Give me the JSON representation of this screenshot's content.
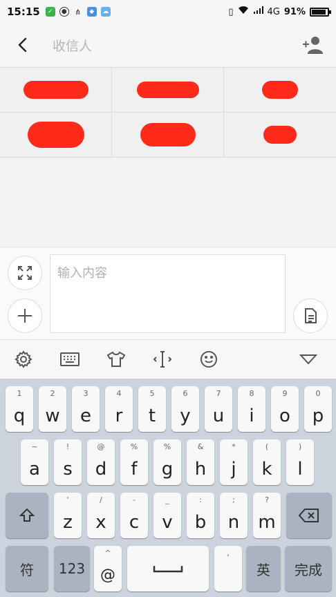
{
  "status_bar": {
    "time": "15:15",
    "network": "4G",
    "battery": "91%",
    "battery_level": 0.91
  },
  "header": {
    "title": "收信人",
    "icons": {
      "back": "chevron-left-icon",
      "add_contact": "add-contact-icon"
    }
  },
  "recipients_grid": {
    "rows": 2,
    "cols": 3
  },
  "compose": {
    "placeholder": "输入内容",
    "icons": {
      "expand": "expand-icon",
      "add": "plus-icon",
      "template": "document-icon"
    }
  },
  "keyboard_toolbar": {
    "icons": [
      "gear-icon",
      "keyboard-icon",
      "tshirt-icon",
      "cursor-icon",
      "emoji-icon",
      "collapse-icon"
    ]
  },
  "keyboard": {
    "row1": [
      {
        "hint": "1",
        "key": "q"
      },
      {
        "hint": "2",
        "key": "w"
      },
      {
        "hint": "3",
        "key": "e"
      },
      {
        "hint": "4",
        "key": "r"
      },
      {
        "hint": "5",
        "key": "t"
      },
      {
        "hint": "6",
        "key": "y"
      },
      {
        "hint": "7",
        "key": "u"
      },
      {
        "hint": "8",
        "key": "i"
      },
      {
        "hint": "9",
        "key": "o"
      },
      {
        "hint": "0",
        "key": "p"
      }
    ],
    "row2": [
      {
        "hint": "~",
        "key": "a"
      },
      {
        "hint": "!",
        "key": "s"
      },
      {
        "hint": "@",
        "key": "d"
      },
      {
        "hint": "%",
        "key": "f"
      },
      {
        "hint": "%",
        "key": "g"
      },
      {
        "hint": "&",
        "key": "h"
      },
      {
        "hint": "*",
        "key": "j"
      },
      {
        "hint": "(",
        "key": "k"
      },
      {
        "hint": ")",
        "key": "l"
      }
    ],
    "row3": [
      {
        "hint": "'",
        "key": "z"
      },
      {
        "hint": "/",
        "key": "x"
      },
      {
        "hint": "-",
        "key": "c"
      },
      {
        "hint": "_",
        "key": "v"
      },
      {
        "hint": ":",
        "key": "b"
      },
      {
        "hint": ";",
        "key": "n"
      },
      {
        "hint": "?",
        "key": "m"
      }
    ],
    "row4": {
      "symbols": "符",
      "numbers": "123",
      "at_hint": "^",
      "at": "@",
      "comma_hint": ",",
      "lang": "英",
      "done": "完成"
    }
  }
}
